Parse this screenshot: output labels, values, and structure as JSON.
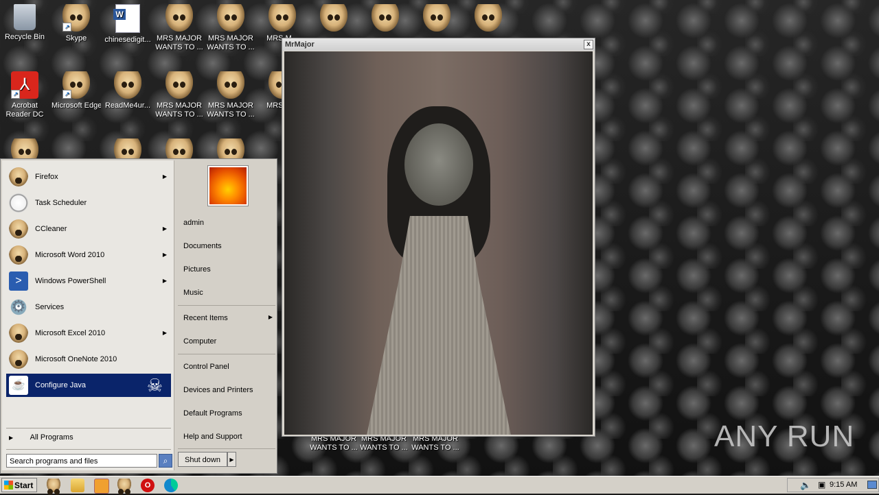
{
  "desktop": {
    "icons_row1": [
      {
        "label": "Recycle Bin",
        "icon": "recycle-bin-icon"
      },
      {
        "label": "Skype",
        "icon": "skull-icon"
      },
      {
        "label": "chinesedigit...",
        "icon": "word-document-icon"
      },
      {
        "label": "MRS MAJOR WANTS TO ...",
        "icon": "skull-icon"
      },
      {
        "label": "MRS MAJOR WANTS TO ...",
        "icon": "skull-icon"
      },
      {
        "label": "MRS M...",
        "icon": "skull-icon"
      }
    ],
    "icons_row2": [
      {
        "label": "Acrobat Reader DC",
        "icon": "acrobat-icon"
      },
      {
        "label": "Microsoft Edge",
        "icon": "skull-icon"
      },
      {
        "label": "ReadMe4ur...",
        "icon": "skull-icon"
      },
      {
        "label": "MRS MAJOR WANTS TO ...",
        "icon": "skull-icon"
      },
      {
        "label": "MRS MAJOR WANTS TO ...",
        "icon": "skull-icon"
      },
      {
        "label": "MRS M...",
        "icon": "skull-icon"
      }
    ],
    "icons_bottom": [
      {
        "label": "MRS MAJOR WANTS TO ..."
      },
      {
        "label": "MRS MAJOR WANTS TO ..."
      },
      {
        "label": "MRS MAJOR WANTS TO ..."
      }
    ],
    "watermark": "ANY RUN"
  },
  "window": {
    "title": "MrMajor",
    "close_label": "x"
  },
  "start_menu": {
    "programs": [
      {
        "label": "Firefox",
        "submenu": true
      },
      {
        "label": "Task Scheduler",
        "submenu": false
      },
      {
        "label": "CCleaner",
        "submenu": true
      },
      {
        "label": "Microsoft Word 2010",
        "submenu": true
      },
      {
        "label": "Windows PowerShell",
        "submenu": true
      },
      {
        "label": "Services",
        "submenu": false
      },
      {
        "label": "Microsoft Excel 2010",
        "submenu": true
      },
      {
        "label": "Microsoft OneNote 2010",
        "submenu": false
      },
      {
        "label": "Configure Java",
        "submenu": false,
        "selected": true
      }
    ],
    "all_programs": "All Programs",
    "search_placeholder": "Search programs and files",
    "right_items": {
      "user": "admin",
      "documents": "Documents",
      "pictures": "Pictures",
      "music": "Music",
      "recent": "Recent Items",
      "computer": "Computer",
      "control_panel": "Control Panel",
      "devices": "Devices and Printers",
      "default_programs": "Default Programs",
      "help": "Help and Support"
    },
    "shutdown": "Shut down"
  },
  "taskbar": {
    "start": "Start",
    "clock": "9:15 AM",
    "colors": {
      "selection": "#0a246a",
      "taskbar": "#d4d0c8"
    }
  }
}
